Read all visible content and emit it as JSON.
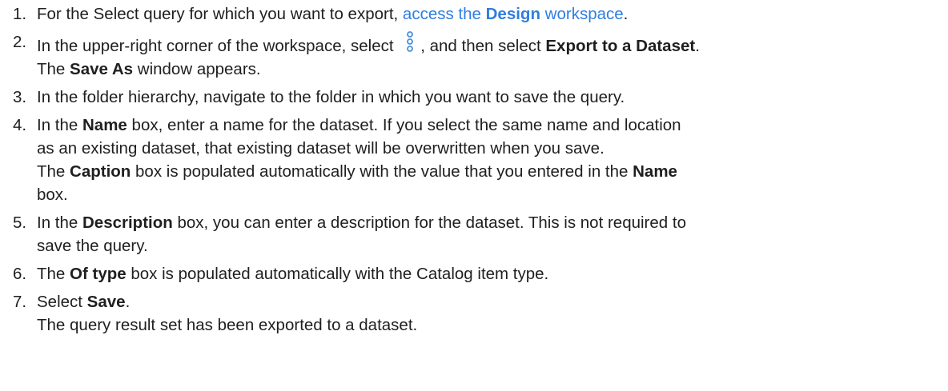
{
  "steps": [
    {
      "num": "1.",
      "text_before": "For the Select query for which you want to export, ",
      "link_pre": "access the ",
      "link_bold": "Design",
      "link_post": " workspace",
      "text_after": "."
    },
    {
      "num": "2.",
      "t1": "In the upper-right corner of the workspace, select ",
      "icon": "more-options-kebab-icon",
      "t2": ", and then select ",
      "b1": "Export to a Dataset",
      "t3": ".",
      "result_b": "Save As",
      "result_t": " window appears.",
      "result_pre": "The "
    },
    {
      "num": "3.",
      "text": "In the folder hierarchy, navigate to the folder in which you want to save the query."
    },
    {
      "num": "4.",
      "t1": "In the ",
      "b1": "Name",
      "t2": " box, enter a name for the dataset. If you select the same name and location",
      "t3": "as an existing dataset, that existing dataset will be overwritten when you save.",
      "r1": "The ",
      "rb1": "Caption",
      "r2": " box is populated automatically with the value that you entered in the ",
      "rb2": "Name",
      "r3": "box."
    },
    {
      "num": "5.",
      "t1": "In the ",
      "b1": "Description",
      "t2": " box, you can enter a description for the dataset. This is not required to",
      "t3": "save the query."
    },
    {
      "num": "6.",
      "t1": "The ",
      "b1": "Of type",
      "t2": " box is populated automatically with the Catalog item type."
    },
    {
      "num": "7.",
      "t1": "Select ",
      "b1": "Save",
      "t2": ".",
      "result": "The query result set has been exported to a dataset."
    }
  ],
  "colors": {
    "text": "#1f1f1f",
    "link": "#2f7ee0",
    "icon": "#4a90d9"
  }
}
